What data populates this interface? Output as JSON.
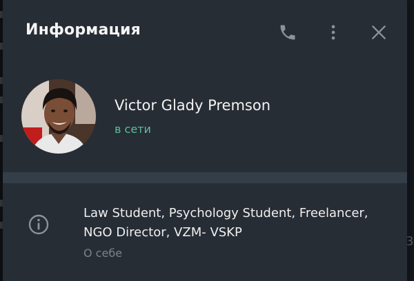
{
  "header": {
    "title": "Информация",
    "icons": [
      "phone-icon",
      "more-vertical-icon",
      "close-icon"
    ]
  },
  "profile": {
    "name": "Victor Glady Premson",
    "status": "в сети",
    "status_color": "#59c09a"
  },
  "about": {
    "icon": "info-icon",
    "lines": [
      "Law Student, Psychology Student, Freelancer,",
      "NGO Director, VZM- VSKP"
    ],
    "label": "О себе"
  },
  "background": {
    "edge_text": "3"
  }
}
